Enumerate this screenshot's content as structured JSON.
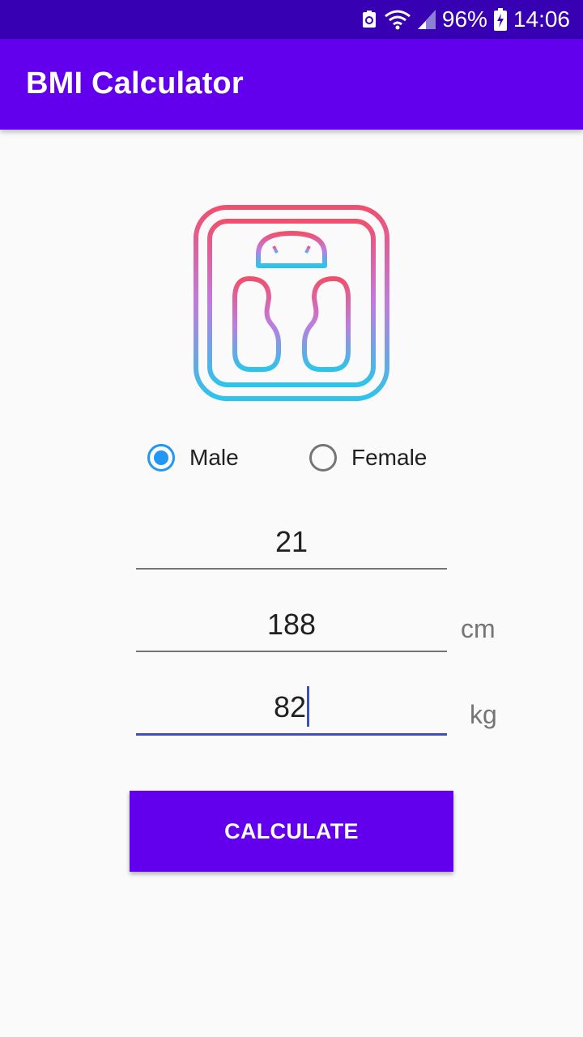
{
  "status_bar": {
    "battery_percent": "96%",
    "time": "14:06",
    "icons": [
      "notification-icon",
      "wifi-icon",
      "signal-icon",
      "battery-charging-icon"
    ]
  },
  "app_bar": {
    "title": "BMI Calculator"
  },
  "logo": {
    "icon": "bathroom-scale-icon",
    "gradient_top": "#f0506e",
    "gradient_middle": "#c07be0",
    "gradient_bottom": "#2ec4ea"
  },
  "gender": {
    "options": [
      {
        "label": "Male",
        "checked": true
      },
      {
        "label": "Female",
        "checked": false
      }
    ]
  },
  "inputs": {
    "age": {
      "value": "21"
    },
    "height": {
      "value": "188",
      "unit": "cm"
    },
    "weight": {
      "value": "82",
      "unit": "kg",
      "focused": true
    }
  },
  "calculate_button": {
    "label": "CALCULATE"
  },
  "colors": {
    "status_bar": "#3700b3",
    "primary": "#6200ee",
    "radio_accent": "#2196f3",
    "focus_underline": "#3f51b5",
    "background": "#fafafa"
  }
}
